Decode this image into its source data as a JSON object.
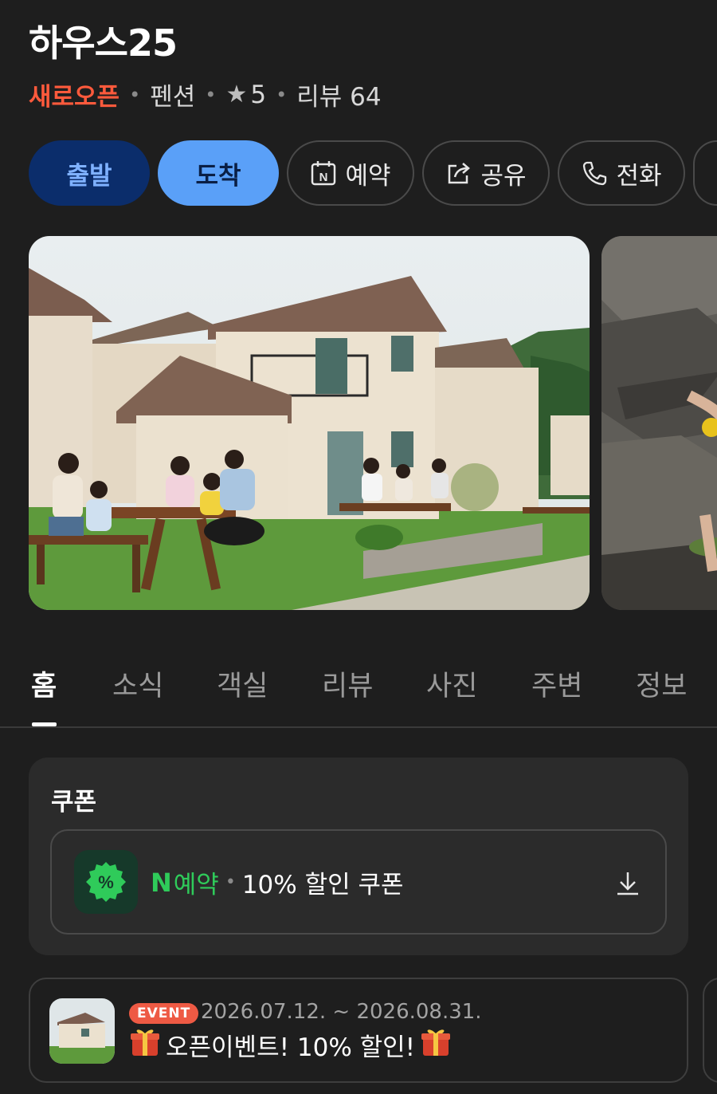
{
  "place": {
    "title": "하우스25",
    "status": "새로오픈",
    "category": "펜션",
    "rating": "5",
    "review_label": "리뷰 64"
  },
  "actions": {
    "depart": "출발",
    "arrive": "도착",
    "reserve": "예약",
    "share": "공유",
    "call": "전화"
  },
  "photos": {
    "main_icon": "pension-houses-photo",
    "side_icon": "rock-stream-photo"
  },
  "tabs": [
    {
      "label": "홈",
      "active": true
    },
    {
      "label": "소식",
      "active": false
    },
    {
      "label": "객실",
      "active": false
    },
    {
      "label": "리뷰",
      "active": false
    },
    {
      "label": "사진",
      "active": false
    },
    {
      "label": "주변",
      "active": false
    },
    {
      "label": "정보",
      "active": false
    }
  ],
  "coupon": {
    "section_title": "쿠폰",
    "brand_logo": "N",
    "brand_label": "예약",
    "text": "10% 할인 쿠폰"
  },
  "event": {
    "badge": "EVENT",
    "date_range": "2026.07.12. ~ 2026.08.31.",
    "title": "오픈이벤트! 10% 할인!"
  },
  "colors": {
    "background": "#1e1e1e",
    "status_red": "#ff5a3c",
    "depart_bg": "#0b2d6b",
    "arrive_bg": "#5aa0f8",
    "naver_green": "#2fcb5a",
    "event_badge": "#ee5a44"
  }
}
